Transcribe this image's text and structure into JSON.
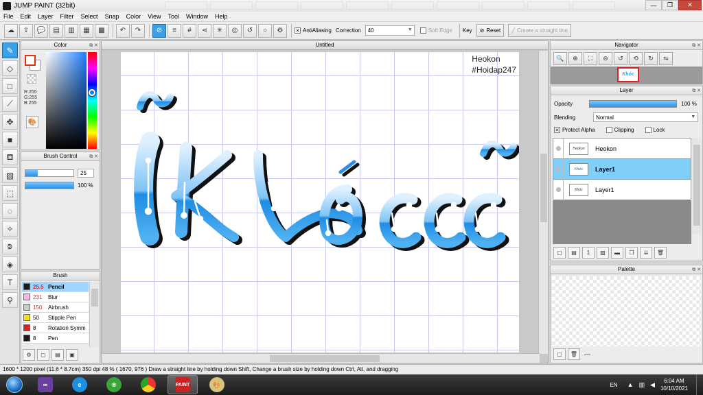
{
  "window": {
    "title": "JUMP PAINT (32bit)",
    "controls": {
      "minimize": "—",
      "restore": "❐",
      "close": "✕"
    }
  },
  "menu": [
    "File",
    "Edit",
    "Layer",
    "Filter",
    "Select",
    "Snap",
    "Color",
    "View",
    "Tool",
    "Window",
    "Help"
  ],
  "toolbar": {
    "antialiasing_label": "AntiAliasing",
    "antialiasing_checked": "✕",
    "correction_label": "Correction",
    "correction_value": "40",
    "soft_edge_label": "Soft Edge",
    "key_label": "Key",
    "reset_label": "Reset",
    "straight_line_label": "Create a straight line"
  },
  "color_panel": {
    "title": "Color",
    "r": "R:255",
    "g": "G:255",
    "b": "B:255",
    "accent": "#3aa0e8"
  },
  "brush_control": {
    "title": "Brush Control",
    "size_value": "25",
    "size_fraction": 0.25,
    "opacity_value": "100 %",
    "opacity_fraction": 1.0
  },
  "brush_panel": {
    "title": "Brush",
    "items": [
      {
        "size": "25.5",
        "name": "Pencil",
        "color": "#1a1a1a"
      },
      {
        "size": "231",
        "name": "Blur",
        "color": "#f5b8e8"
      },
      {
        "size": "150",
        "name": "Airbrush",
        "color": "#cccccc"
      },
      {
        "size": "50",
        "name": "Stipple Pen",
        "color": "#f0e020"
      },
      {
        "size": "8",
        "name": "Rotation Symm",
        "color": "#e02020"
      },
      {
        "size": "8",
        "name": "Pen",
        "color": "#1a1a1a"
      }
    ]
  },
  "canvas": {
    "tab_title": "Untitled",
    "watermark_line1": "Heokon",
    "watermark_line2": "#Hoidap247",
    "artwork_text": "Khóc"
  },
  "navigator": {
    "title": "Navigator",
    "thumb_text": "Khóc"
  },
  "layer_panel": {
    "title": "Layer",
    "opacity_label": "Opacity",
    "opacity_value": "100 %",
    "blending_label": "Blending",
    "blending_value": "Normal",
    "protect_alpha_label": "Protect Alpha",
    "protect_alpha_checked": "✕",
    "clipping_label": "Clipping",
    "lock_label": "Lock",
    "layers": [
      {
        "name": "Heokon",
        "thumb": "Heokon #Hoidap247",
        "selected": false
      },
      {
        "name": "Layer1",
        "thumb": "Khóc",
        "selected": true
      },
      {
        "name": "Layer1",
        "thumb": "Khóc",
        "selected": false
      }
    ]
  },
  "palette_panel": {
    "title": "Palette",
    "footer_text": "---"
  },
  "status": {
    "text": "1600 * 1200 pixel   (11.6 * 8.7cm)   350 dpi   48 %   ( 1670, 976 )   Draw a straight line by holding down Shift, Change a brush size by holding down Ctrl, Alt, and dragging"
  },
  "taskbar": {
    "language": "EN",
    "time": "6:04 AM",
    "date": "10/10/2021",
    "paint_label": "PAINT"
  }
}
